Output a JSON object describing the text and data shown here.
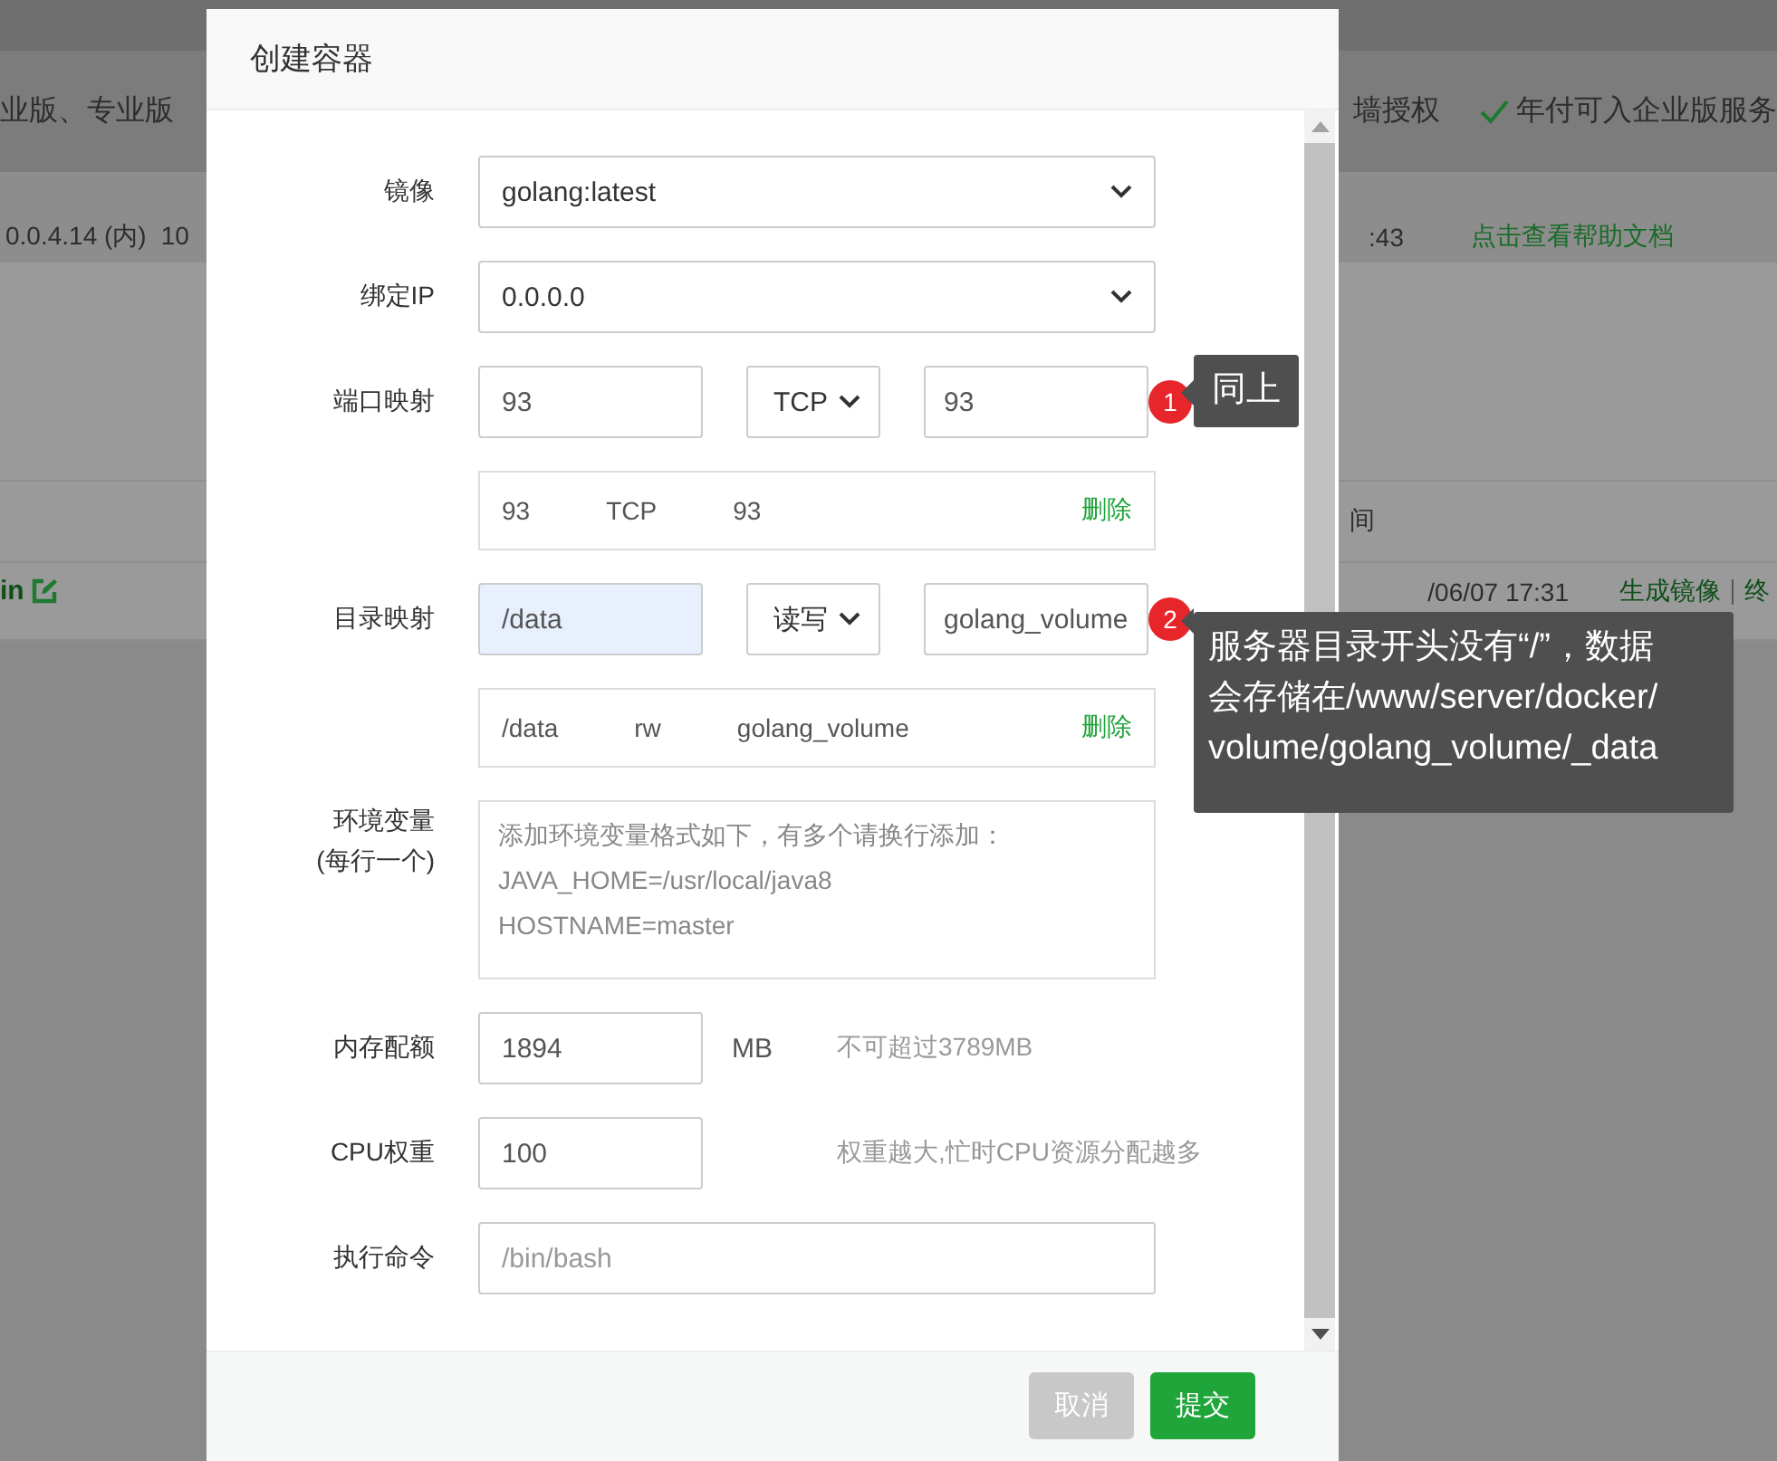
{
  "background": {
    "banner": {
      "left_text": "业版、专业版",
      "right_text": "墙授权",
      "right_note": "年付可入企业版服务"
    },
    "server_row": {
      "address": "0.0.4.14 (内)",
      "address_extra": "10",
      "time": ":43",
      "help_link": "点击查看帮助文档"
    },
    "table": {
      "column_header": "间",
      "row": {
        "name": "in",
        "date": "/06/07 17:31",
        "actions": [
          "生成镜像",
          "终"
        ]
      }
    }
  },
  "dialog": {
    "title": "创建容器",
    "fields": [
      {
        "kind": "select",
        "label": "镜像",
        "value": "golang:latest"
      },
      {
        "kind": "select",
        "label": "绑定IP",
        "value": "0.0.0.0"
      },
      {
        "kind": "mapping",
        "label": "端口映射",
        "host": "93",
        "mode": "TCP",
        "container": "93",
        "highlighted": false,
        "hint": {
          "number": "1",
          "lines": [
            "同上"
          ]
        }
      },
      {
        "kind": "list",
        "entries": [
          {
            "cols": [
              "93",
              "TCP",
              "93"
            ],
            "action": "删除"
          }
        ]
      },
      {
        "kind": "mapping",
        "label": "目录映射",
        "host": "/data",
        "mode": "读写",
        "container": "golang_volume",
        "highlighted": true,
        "hint": {
          "number": "2",
          "lines": [
            "服务器目录开头没有“/”，数据",
            "会存储在/www/server/docker/",
            "volume/golang_volume/_data"
          ]
        }
      },
      {
        "kind": "list",
        "entries": [
          {
            "cols": [
              "/data",
              "rw",
              "golang_volume"
            ],
            "action": "删除"
          }
        ]
      },
      {
        "kind": "textarea",
        "label": "环境变量",
        "sublabel": "(每行一个)",
        "placeholder": "添加环境变量格式如下，有多个请换行添加：\nJAVA_HOME=/usr/local/java8\nHOSTNAME=master"
      },
      {
        "kind": "number",
        "label": "内存配额",
        "value": "1894",
        "unit": "MB",
        "note": "不可超过3789MB"
      },
      {
        "kind": "number",
        "label": "CPU权重",
        "value": "100",
        "note": "权重越大,忙时CPU资源分配越多"
      },
      {
        "kind": "text",
        "label": "执行命令",
        "placeholder": "/bin/bash"
      }
    ],
    "buttons": [
      {
        "label": "取消",
        "kind": "cancel"
      },
      {
        "label": "提交",
        "kind": "submit"
      }
    ]
  }
}
